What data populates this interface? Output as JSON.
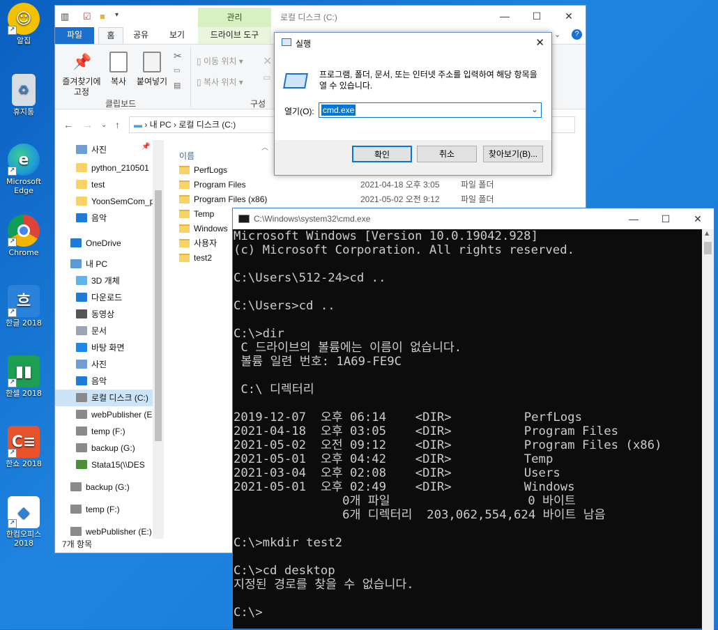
{
  "desktop": {
    "icons": [
      {
        "label": "알집",
        "icon": "alzip-icon",
        "color": "#f2c200"
      },
      {
        "label": "휴지통",
        "icon": "recycle-bin-icon",
        "color": "#d8dde3"
      },
      {
        "label": "Microsoft Edge",
        "icon": "edge-icon",
        "color": "#1f9bd8"
      },
      {
        "label": "Chrome",
        "icon": "chrome-icon",
        "color": "#db4437"
      },
      {
        "label": "한글 2018",
        "icon": "hangul-icon",
        "color": "#2a82da"
      },
      {
        "label": "한셀 2018",
        "icon": "hancell-icon",
        "color": "#1e9e52"
      },
      {
        "label": "한쇼 2018",
        "icon": "hanshow-icon",
        "color": "#e8532c"
      },
      {
        "label": "한컴오피스 2018",
        "icon": "hancom-office-icon",
        "color": "#ffffff"
      }
    ]
  },
  "explorer": {
    "title_tab_manage": "관리",
    "window_title": "로컬 디스크 (C:)",
    "ribbon_tabs": [
      "파일",
      "홈",
      "공유",
      "보기",
      "드라이브 도구"
    ],
    "ribbon": {
      "pin_label": "즐겨찾기에 고정",
      "copy_label": "복사",
      "paste_label": "붙여넣기",
      "clipboard_group": "클립보드",
      "move_to": "이동 위치",
      "copy_to": "복사 위치",
      "organize_group": "구성"
    },
    "address": {
      "pc": "내 PC",
      "drive": "로컬 디스크 (C:)"
    },
    "nav_items": [
      {
        "label": "사진",
        "icon": "pictures-icon",
        "color": "#6f9ed3"
      },
      {
        "label": "python_210501",
        "icon": "folder-icon",
        "color": "#f8d468"
      },
      {
        "label": "test",
        "icon": "folder-icon",
        "color": "#f8d468"
      },
      {
        "label": "YoonSemCom_p",
        "icon": "folder-icon",
        "color": "#f8d468"
      },
      {
        "label": "음악",
        "icon": "music-icon",
        "color": "#1e7bd6"
      },
      {
        "label": "OneDrive",
        "icon": "onedrive-icon",
        "color": "#1e7bd6"
      },
      {
        "label": "내 PC",
        "icon": "pc-icon",
        "color": "#5b9bd5"
      },
      {
        "label": "3D 개체",
        "icon": "3d-objects-icon",
        "color": "#5fb3e8"
      },
      {
        "label": "다운로드",
        "icon": "downloads-icon",
        "color": "#1e7bd6"
      },
      {
        "label": "동영상",
        "icon": "videos-icon",
        "color": "#555555"
      },
      {
        "label": "문서",
        "icon": "documents-icon",
        "color": "#9aa5b1"
      },
      {
        "label": "바탕 화면",
        "icon": "desktop-folder-icon",
        "color": "#1e88e5"
      },
      {
        "label": "사진",
        "icon": "pictures-icon",
        "color": "#6f9ed3"
      },
      {
        "label": "음악",
        "icon": "music-icon",
        "color": "#1e7bd6"
      },
      {
        "label": "로컬 디스크 (C:)",
        "icon": "drive-c-icon",
        "color": "#8a8a8a"
      },
      {
        "label": "webPublisher (E",
        "icon": "network-drive-icon",
        "color": "#8a8a8a"
      },
      {
        "label": "temp (F:)",
        "icon": "network-drive-icon",
        "color": "#8a8a8a"
      },
      {
        "label": "backup (G:)",
        "icon": "network-drive-icon",
        "color": "#8a8a8a"
      },
      {
        "label": "Stata15(\\\\DES",
        "icon": "network-drive-icon",
        "color": "#4a8f3a"
      },
      {
        "label": "backup (G:)",
        "icon": "network-drive-icon",
        "color": "#8a8a8a"
      },
      {
        "label": "temp (F:)",
        "icon": "network-drive-icon",
        "color": "#8a8a8a"
      },
      {
        "label": "webPublisher (E:)",
        "icon": "network-drive-icon",
        "color": "#8a8a8a"
      }
    ],
    "column_name": "이름",
    "files": [
      {
        "name": "PerfLogs",
        "date": "",
        "type": ""
      },
      {
        "name": "Program Files",
        "date": "2021-04-18 오후 3:05",
        "type": "파일 폴더"
      },
      {
        "name": "Program Files (x86)",
        "date": "2021-05-02 오전 9:12",
        "type": "파일 폴더"
      },
      {
        "name": "Temp",
        "date": "",
        "type": ""
      },
      {
        "name": "Windows",
        "date": "",
        "type": ""
      },
      {
        "name": "사용자",
        "date": "",
        "type": ""
      },
      {
        "name": "test2",
        "date": "",
        "type": ""
      }
    ],
    "status": "7개 항목",
    "colors": {
      "file_tab": "#1a6fcf",
      "manage_tab": "#d9f0c2",
      "selection": "#cce4f7"
    }
  },
  "run_dialog": {
    "title": "실행",
    "description": "프로그램, 폴더, 문서, 또는 인터넷 주소를 입력하여 해당 항목을 열 수 있습니다.",
    "open_label": "열기(O):",
    "input_value": "cmd.exe",
    "ok": "확인",
    "cancel": "취소",
    "browse": "찾아보기(B)..."
  },
  "cmd": {
    "title": "C:\\Windows\\system32\\cmd.exe",
    "lines": [
      "Microsoft Windows [Version 10.0.19042.928]",
      "(c) Microsoft Corporation. All rights reserved.",
      "",
      "C:\\Users\\512-24>cd ..",
      "",
      "C:\\Users>cd ..",
      "",
      "C:\\>dir",
      " C 드라이브의 볼륨에는 이름이 없습니다.",
      " 볼륨 일련 번호: 1A69-FE9C",
      "",
      " C:\\ 디렉터리",
      "",
      "2019-12-07  오후 06:14    <DIR>          PerfLogs",
      "2021-04-18  오후 03:05    <DIR>          Program Files",
      "2021-05-02  오전 09:12    <DIR>          Program Files (x86)",
      "2021-05-01  오후 04:42    <DIR>          Temp",
      "2021-03-04  오후 02:08    <DIR>          Users",
      "2021-05-01  오후 02:49    <DIR>          Windows",
      "               0개 파일                   0 바이트",
      "               6개 디렉터리  203,062,554,624 바이트 남음",
      "",
      "C:\\>mkdir test2",
      "",
      "C:\\>cd desktop",
      "지정된 경로를 찾을 수 없습니다.",
      "",
      "C:\\>"
    ]
  }
}
